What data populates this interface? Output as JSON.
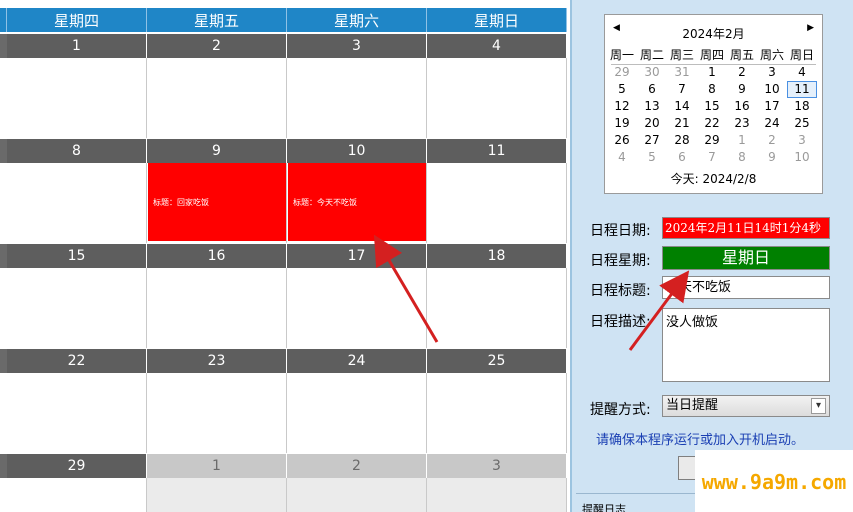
{
  "calendar": {
    "weekday_headers": [
      "星期四",
      "星期五",
      "星期六",
      "星期日"
    ],
    "weeks": [
      {
        "days": [
          "1",
          "2",
          "3",
          "4"
        ]
      },
      {
        "days": [
          "8",
          "9",
          "10",
          "11"
        ]
      },
      {
        "days": [
          "15",
          "16",
          "17",
          "18"
        ]
      },
      {
        "days": [
          "22",
          "23",
          "24",
          "25"
        ]
      },
      {
        "days": [
          "29",
          "1",
          "2",
          "3"
        ]
      }
    ],
    "events": {
      "day9": "标题：回家吃饭",
      "day10": "标题：今天不吃饭"
    }
  },
  "minical": {
    "prev": "◀",
    "next": "▶",
    "title": "2024年2月",
    "weekdays": [
      "周一",
      "周二",
      "周三",
      "周四",
      "周五",
      "周六",
      "周日"
    ],
    "rows": [
      [
        "29",
        "30",
        "31",
        "1",
        "2",
        "3",
        "4"
      ],
      [
        "5",
        "6",
        "7",
        "8",
        "9",
        "10",
        "11"
      ],
      [
        "12",
        "13",
        "14",
        "15",
        "16",
        "17",
        "18"
      ],
      [
        "19",
        "20",
        "21",
        "22",
        "23",
        "24",
        "25"
      ],
      [
        "26",
        "27",
        "28",
        "29",
        "1",
        "2",
        "3"
      ],
      [
        "4",
        "5",
        "6",
        "7",
        "8",
        "9",
        "10"
      ]
    ],
    "selected": "11",
    "today_label": "今天: 2024/2/8"
  },
  "form": {
    "date_label": "日程日期:",
    "date_value": "2024年2月11日14时1分4秒",
    "week_label": "日程星期:",
    "week_value": "星期日",
    "title_label": "日程标题:",
    "title_value": "今天不吃饭",
    "desc_label": "日程描述:",
    "desc_value": "没人做饭",
    "remind_label": "提醒方式:",
    "remind_value": "当日提醒",
    "notice": "请确保本程序运行或加入开机启动。",
    "log_label": "提醒日志"
  },
  "watermark": "www.9a9m.com",
  "colors": {
    "header_blue": "#1f86c7",
    "event_red": "#ff0000",
    "week_green": "#008000",
    "arrow_red": "#d42020"
  }
}
